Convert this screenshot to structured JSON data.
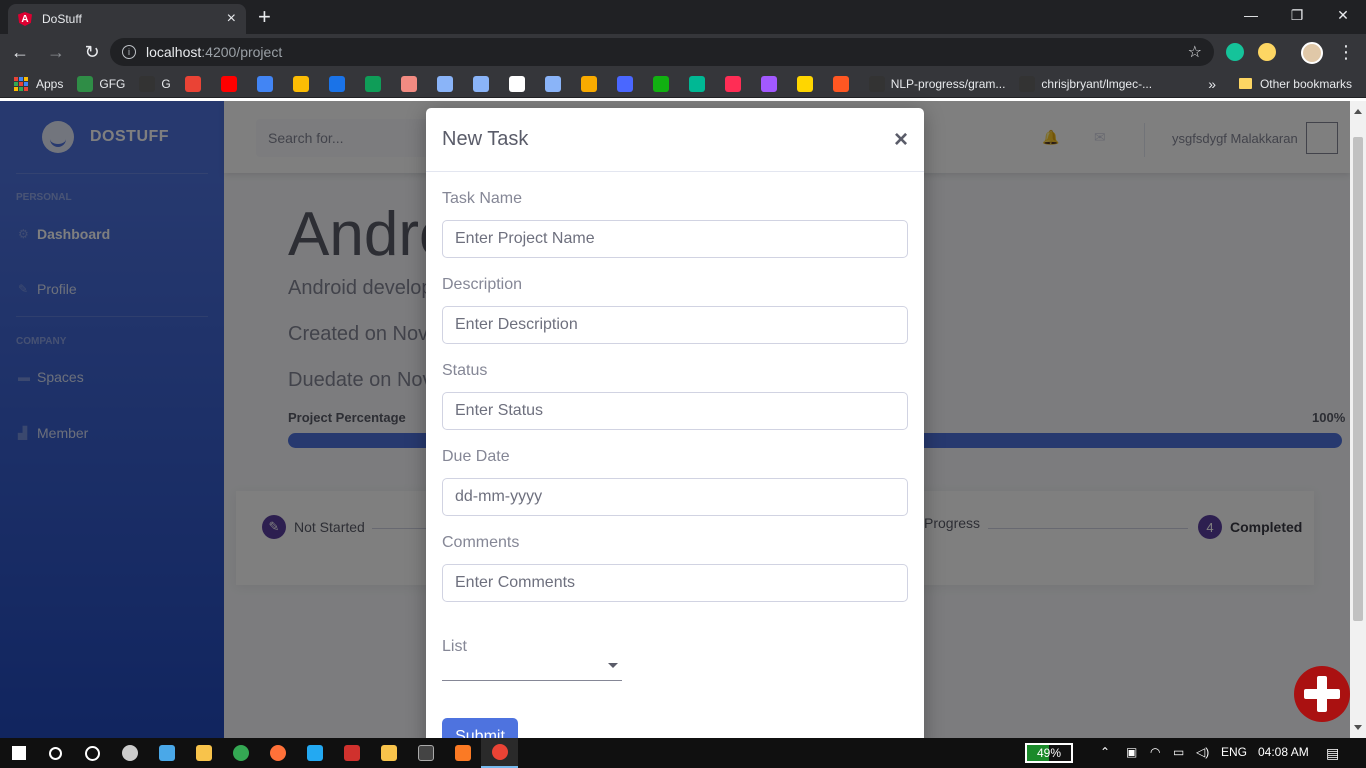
{
  "browser": {
    "tab_title": "DoStuff",
    "tab_close": "×",
    "new_tab": "+",
    "url_host": "localhost",
    "url_path": ":4200/project",
    "bookmarks": [
      {
        "label": "Apps",
        "color": "#4285f4"
      },
      {
        "label": "GFG",
        "color": "#2f8d46"
      },
      {
        "label": "G",
        "color": "#333333"
      },
      {
        "label": "",
        "color": "#ea4335"
      },
      {
        "label": "",
        "color": "#ff0000"
      },
      {
        "label": "",
        "color": "#4285f4"
      },
      {
        "label": "",
        "color": "#fbbc04"
      },
      {
        "label": "",
        "color": "#1a73e8"
      },
      {
        "label": "",
        "color": "#0f9d58"
      },
      {
        "label": "",
        "color": "#f28b82"
      },
      {
        "label": "",
        "color": "#8ab4f8"
      },
      {
        "label": "",
        "color": "#8ab4f8"
      },
      {
        "label": "",
        "color": "#ffffff"
      },
      {
        "label": "",
        "color": "#8ab4f8"
      },
      {
        "label": "",
        "color": "#f9ab00"
      },
      {
        "label": "",
        "color": "#4a67ff"
      },
      {
        "label": "",
        "color": "#11b111"
      },
      {
        "label": "",
        "color": "#00b894"
      },
      {
        "label": "",
        "color": "#ff2d55"
      },
      {
        "label": "",
        "color": "#a259ff"
      },
      {
        "label": "",
        "color": "#ffd600"
      },
      {
        "label": "",
        "color": "#ff5722"
      },
      {
        "label": "NLP-progress/gram...",
        "color": "#333333"
      },
      {
        "label": "chrisjbryant/lmgec-...",
        "color": "#333333"
      }
    ],
    "bookmarks_more": "»",
    "other_bookmarks": "Other bookmarks"
  },
  "sidebar": {
    "brand": "DOSTUFF",
    "heading_personal": "PERSONAL",
    "heading_company": "COMPANY",
    "items": [
      {
        "label": "Dashboard",
        "icon": "⚙",
        "active": true
      },
      {
        "label": "Profile",
        "icon": "🔧"
      },
      {
        "label": "Spaces",
        "icon": "▭"
      },
      {
        "label": "Member",
        "icon": "▥"
      }
    ]
  },
  "topbar": {
    "search_placeholder": "Search for...",
    "username": "ysgfsdygf Malakkaran"
  },
  "project": {
    "title": "Andro",
    "description": "Android develop",
    "created": "Created on Nov",
    "duedate": "Duedate on Nov",
    "percentage_label": "Project Percentage",
    "percentage_value": "100%",
    "percentage": 100
  },
  "steps": [
    {
      "num": "",
      "label": "Not Started"
    },
    {
      "num": "",
      "label": "Progress"
    },
    {
      "num": "4",
      "label": "Completed"
    }
  ],
  "modal": {
    "title": "New Task",
    "close": "×",
    "fields": [
      {
        "label": "Task Name",
        "placeholder": "Enter Project Name"
      },
      {
        "label": "Description",
        "placeholder": "Enter Description"
      },
      {
        "label": "Status",
        "placeholder": "Enter Status"
      },
      {
        "label": "Due Date",
        "placeholder": "dd-mm-yyyy"
      },
      {
        "label": "Comments",
        "placeholder": "Enter Comments"
      }
    ],
    "list_label": "List",
    "submit": "Submit"
  },
  "taskbar": {
    "battery": "49%",
    "battery_level": 0.49,
    "language": "ENG",
    "time": "04:08 AM"
  },
  "colors": {
    "primary": "#4e73df",
    "fab": "#aa1111"
  }
}
